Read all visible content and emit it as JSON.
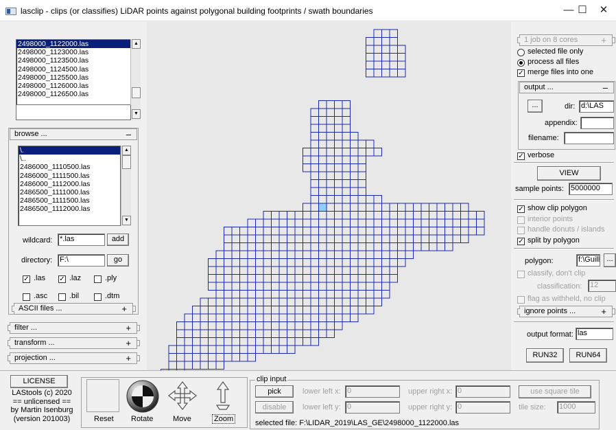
{
  "window": {
    "title": "lasclip - clips (or classifies) LiDAR points against polygonal building footprints / swath boundaries",
    "minimize": "—",
    "maximize": "☐",
    "close": "✕"
  },
  "files": {
    "items": [
      "2498000_1122000.las",
      "2498000_1123000.las",
      "2498000_1123500.las",
      "2498000_1124500.las",
      "2498000_1125500.las",
      "2498000_1126000.las",
      "2498000_1126500.las"
    ],
    "selected_index": 0
  },
  "browse": {
    "label": "browse ...",
    "toggle": "–",
    "items": [
      "\\.",
      "\\..",
      "2486000_1110500.las",
      "2486000_1111500.las",
      "2486000_1112000.las",
      "2486500_1111000.las",
      "2486500_1111500.las",
      "2486500_1112000.las"
    ],
    "selected_index": 0,
    "wildcard_label": "wildcard:",
    "wildcard_value": "*.las",
    "add_label": "add",
    "directory_label": "directory:",
    "directory_value": "F:\\",
    "go_label": "go",
    "types": [
      {
        "label": ".las",
        "checked": true
      },
      {
        "label": ".laz",
        "checked": true
      },
      {
        "label": ".ply",
        "checked": false
      },
      {
        "label": ".asc",
        "checked": false
      },
      {
        "label": ".bil",
        "checked": false
      },
      {
        "label": ".dtm",
        "checked": false
      }
    ],
    "ascii_label": "ASCII files ...",
    "ascii_toggle": "+"
  },
  "left_rollups": [
    {
      "label": "filter ...",
      "toggle": "+"
    },
    {
      "label": "transform ...",
      "toggle": "+"
    },
    {
      "label": "projection ...",
      "toggle": "+"
    }
  ],
  "right_panel": {
    "cores_label": "1 job on 8 cores",
    "cores_toggle": "+",
    "selected_file_only": "selected file only",
    "process_all_files": "process all files",
    "merge_files": "merge files into one",
    "output_label": "output ...",
    "output_toggle": "–",
    "browse_dots": "...",
    "dir_label": "dir:",
    "dir_value": "d:\\LAS",
    "appendix_label": "appendix:",
    "appendix_value": "",
    "filename_label": "filename:",
    "filename_value": "",
    "verbose": "verbose",
    "view_label": "VIEW",
    "sample_points_label": "sample points:",
    "sample_points_value": "5000000",
    "show_clip_polygon": "show clip polygon",
    "interior_points": "interior points",
    "handle_donuts": "handle donuts / islands",
    "split_by_polygon": "split by polygon",
    "polygon_label": "polygon:",
    "polygon_value": "f:\\Guillau",
    "polygon_dots": "...",
    "classify_label": "classify, don't clip",
    "classification_label": "classification:",
    "classification_value": "12",
    "flag_withheld": "flag as withheld, no clip",
    "ignore_points_label": "ignore points ...",
    "ignore_toggle": "+",
    "output_format_label": "output format:",
    "output_format_value": "las",
    "run32": "RUN32",
    "run64": "RUN64"
  },
  "bottom": {
    "license_button": "LICENSE",
    "license_lines": [
      "LAStools (c) 2020",
      "== unlicensed ==",
      "by Martin Isenburg",
      "(version 201003)"
    ],
    "reset": "Reset",
    "rotate": "Rotate",
    "move": "Move",
    "zoom": "Zoom",
    "clip_input_title": "clip input",
    "pick": "pick",
    "disable": "disable",
    "lower_left_x_label": "lower left x:",
    "lower_left_x_value": "0",
    "lower_left_y_label": "lower left y:",
    "lower_left_y_value": "0",
    "upper_right_x_label": "upper right x:",
    "upper_right_x_value": "0",
    "upper_right_y_label": "upper right y:",
    "upper_right_y_value": "0",
    "use_square_tile": "use square tile",
    "tile_size_label": "tile size:",
    "tile_size_value": "1000",
    "selected_file": "selected file: F:\\LIDAR_2019\\LAS_GE\\2498000_1122000.las"
  },
  "colors": {
    "tile_stroke": "#1a27b0",
    "selection": "#0a1f7a",
    "canvas_bg": "#e8e8e8"
  }
}
